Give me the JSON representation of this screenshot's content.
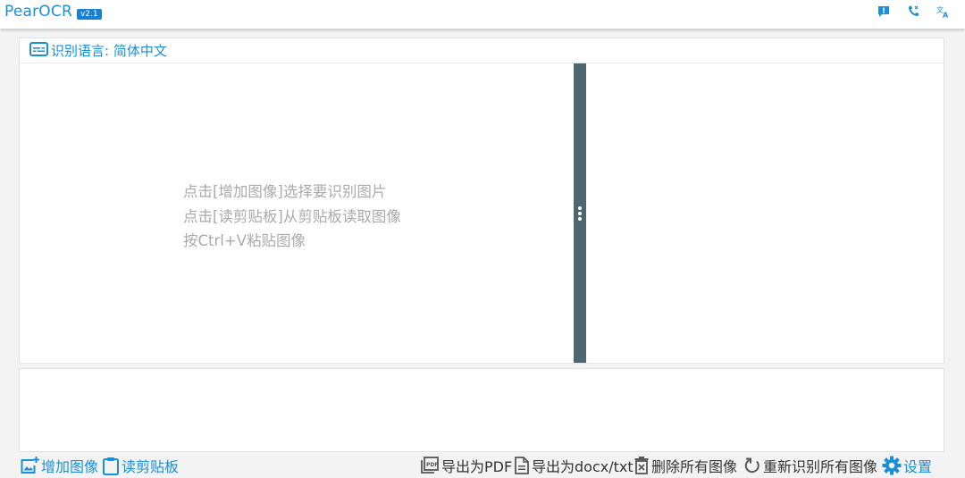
{
  "app": {
    "name": "PearOCR",
    "version": "v2.1"
  },
  "top_icons": [
    "feedback-icon",
    "phone-icon",
    "translate-icon"
  ],
  "language": {
    "label": "识别语言: 简体中文"
  },
  "hints": [
    "点击[增加图像]选择要识别图片",
    "点击[读剪贴板]从剪贴板读取图像",
    "按Ctrl+V粘贴图像"
  ],
  "toolbar": {
    "add_image": "增加图像",
    "read_clipboard": "读剪贴板",
    "export_pdf": "导出为PDF",
    "export_docx": "导出为docx/txt",
    "delete_all": "删除所有图像",
    "rerecognize": "重新识别所有图像",
    "settings": "设置"
  },
  "colors": {
    "accent": "#1b8fd6",
    "splitter": "#4e6670",
    "hint": "#aaaaaa",
    "dark_text": "#333333"
  }
}
